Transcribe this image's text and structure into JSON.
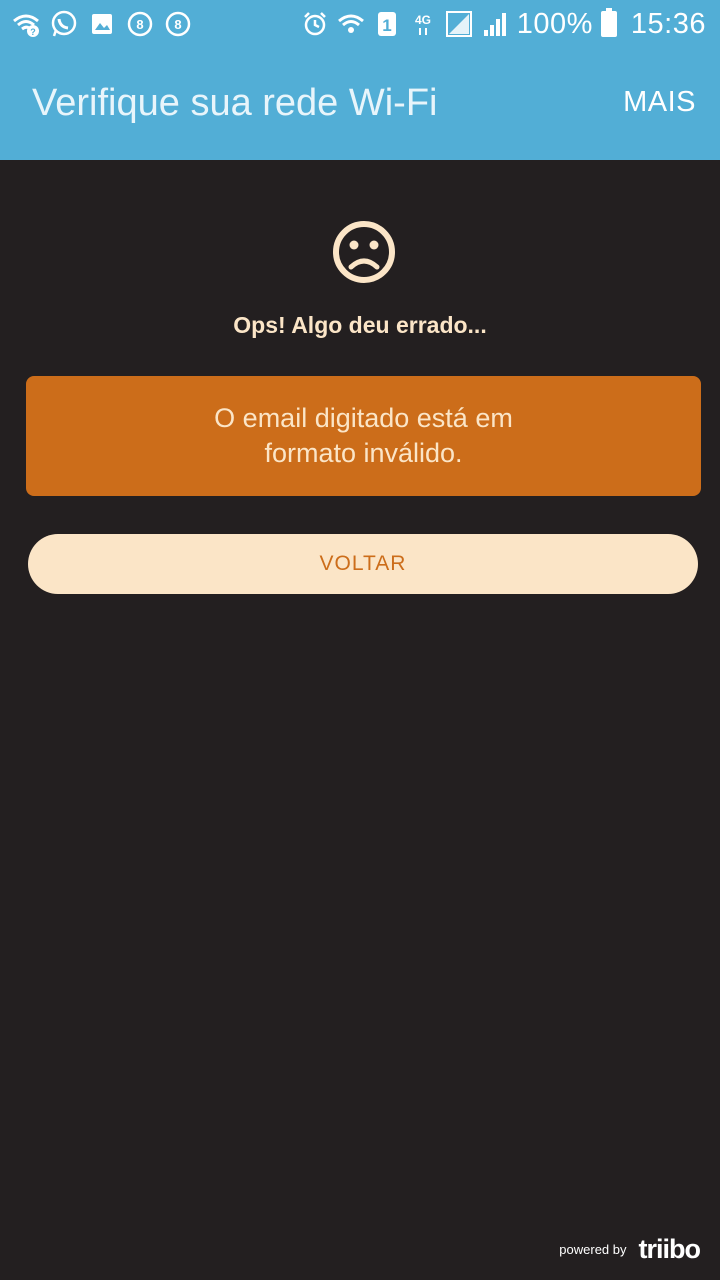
{
  "status_bar": {
    "left_icons": [
      "wifi-question-icon",
      "whatsapp-icon",
      "image-icon",
      "circle-8-icon",
      "circle-8-icon"
    ],
    "right_icons": [
      "alarm-icon",
      "wifi-icon",
      "sim-1-icon",
      "network-4g-icon",
      "signal-icon",
      "signal-icon"
    ],
    "network_type": "4G",
    "sim_label": "1",
    "battery": "100%",
    "time": "15:36"
  },
  "app_bar": {
    "title": "Verifique sua rede Wi-Fi",
    "more_label": "MAIS"
  },
  "error": {
    "icon": "sad-face-icon",
    "heading": "Ops! Algo deu errado...",
    "message": "O email digitado está em formato inválido."
  },
  "actions": {
    "back_label": "VOLTAR"
  },
  "footer": {
    "powered_text": "powered by",
    "brand": "triibo"
  },
  "colors": {
    "app_bar": "#52aed6",
    "background": "#231f20",
    "accent": "#cc6d1a",
    "cream": "#fbe5c7"
  }
}
